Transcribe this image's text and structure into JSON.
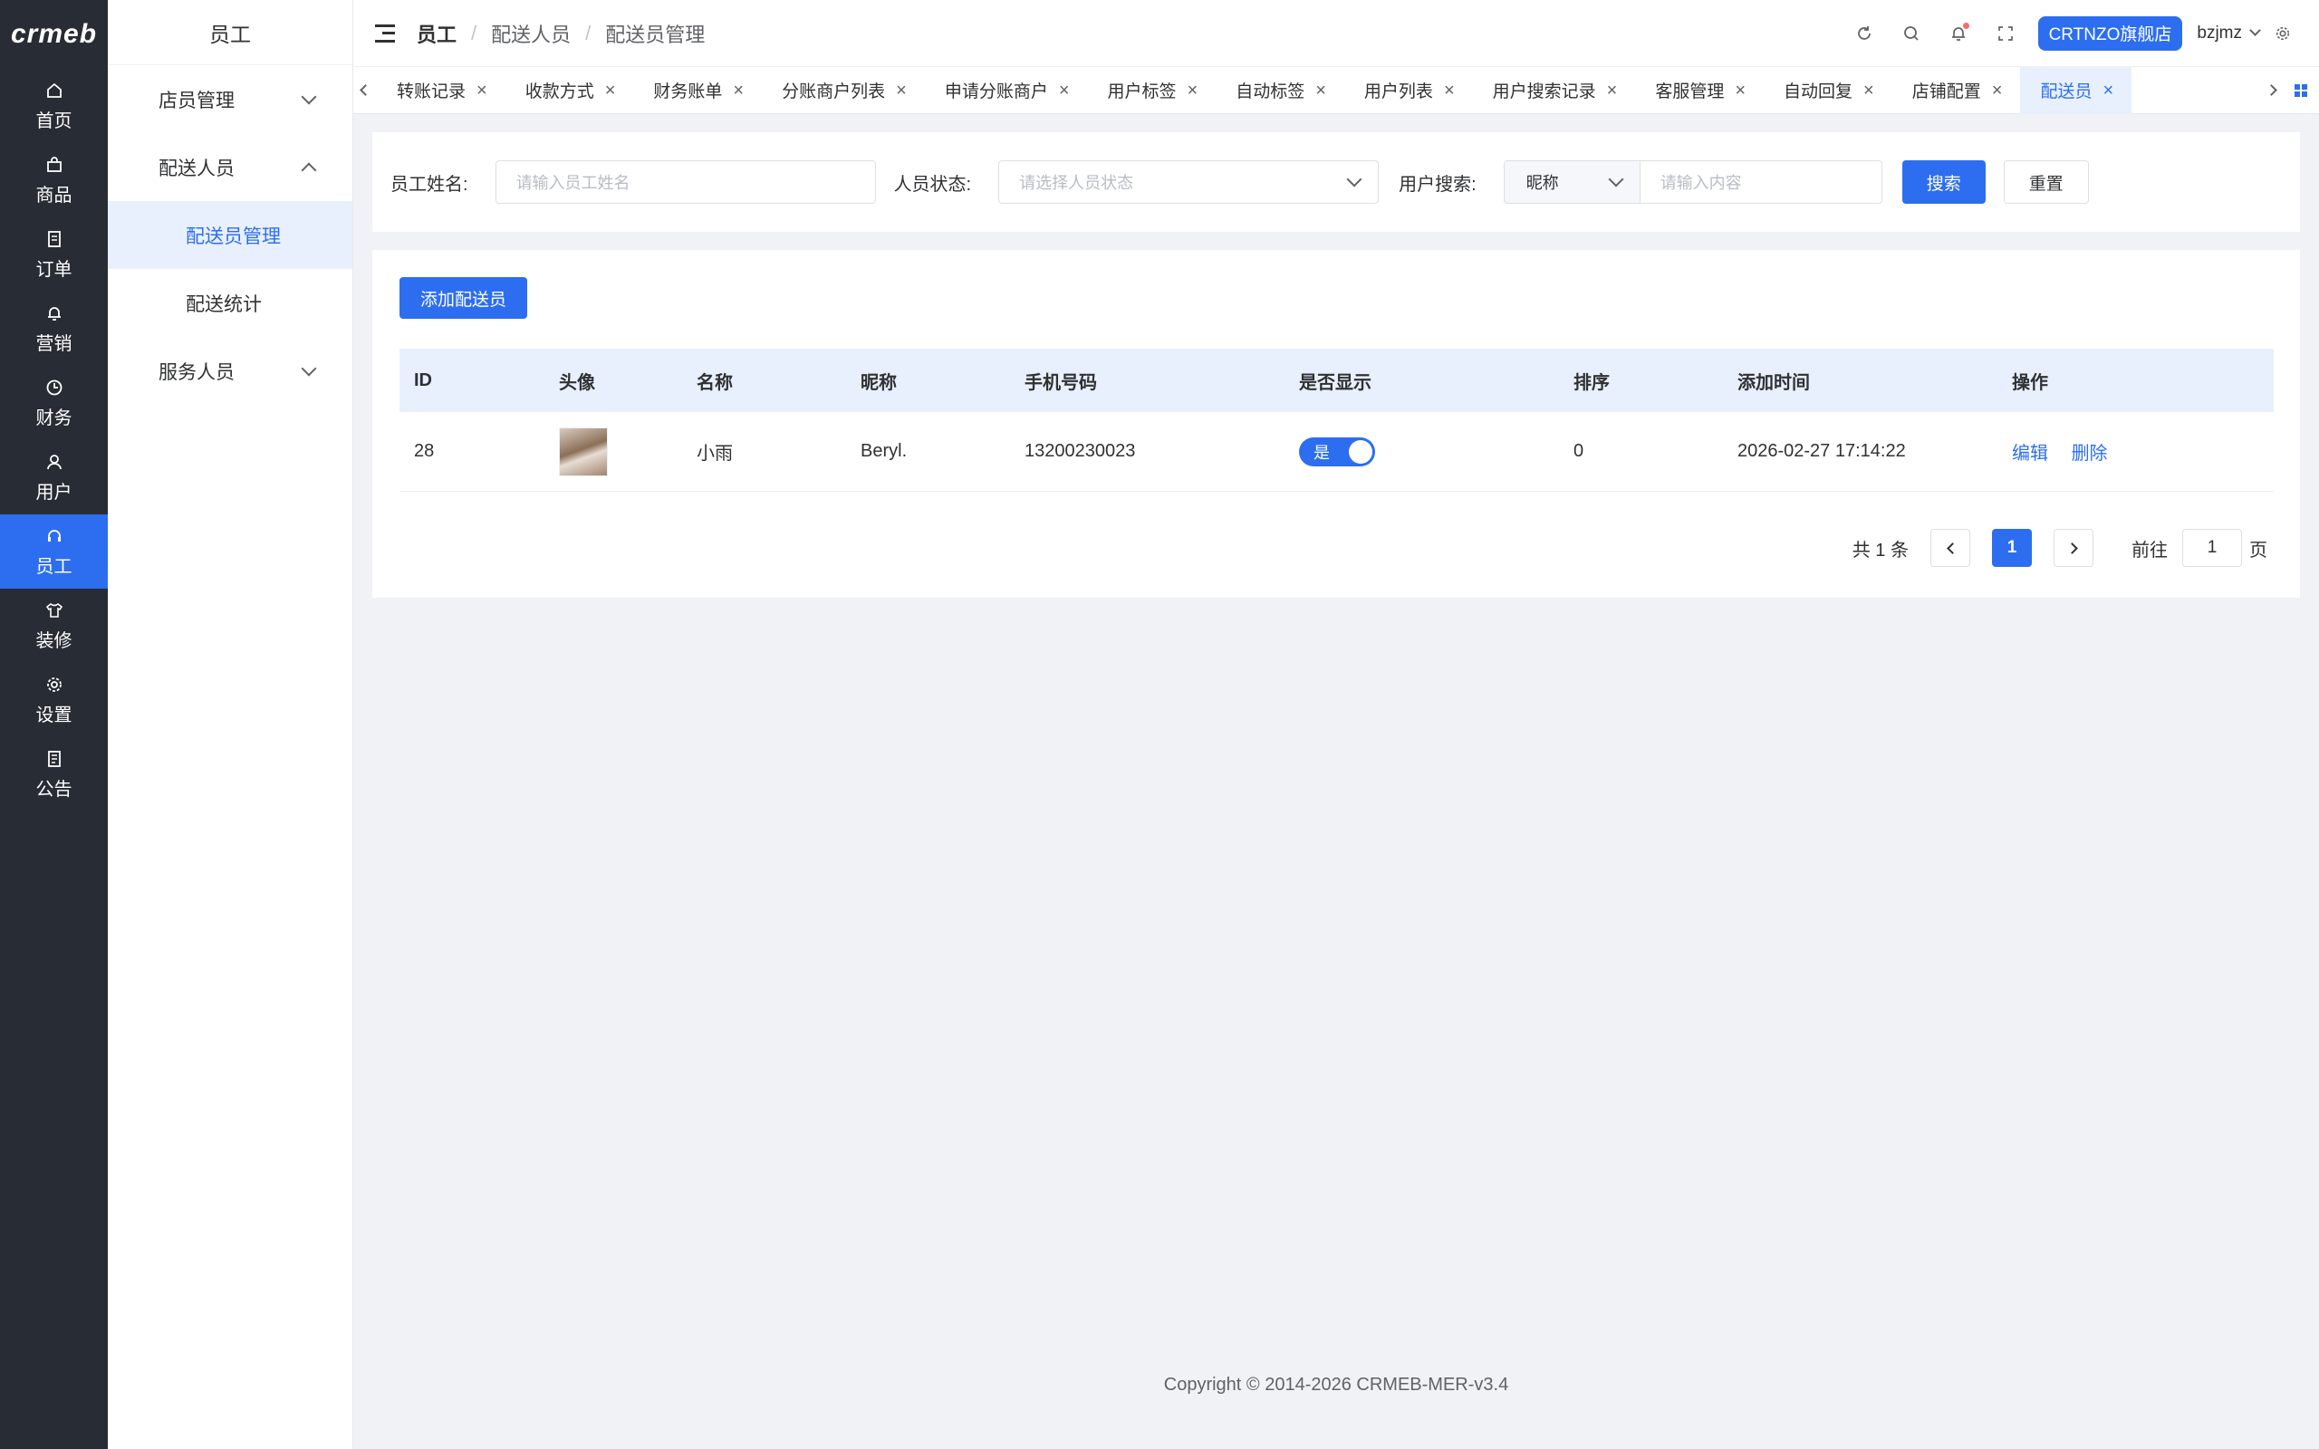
{
  "rail": {
    "logo": "crmeb",
    "items": [
      {
        "label": "首页",
        "icon": "home-icon"
      },
      {
        "label": "商品",
        "icon": "bag-icon"
      },
      {
        "label": "订单",
        "icon": "doc-icon"
      },
      {
        "label": "营销",
        "icon": "bell-icon"
      },
      {
        "label": "财务",
        "icon": "clock-icon"
      },
      {
        "label": "用户",
        "icon": "user-icon"
      },
      {
        "label": "员工",
        "icon": "headset-icon"
      },
      {
        "label": "装修",
        "icon": "shirt-icon"
      },
      {
        "label": "设置",
        "icon": "gear-icon"
      },
      {
        "label": "公告",
        "icon": "notice-icon"
      }
    ]
  },
  "submenu": {
    "title": "员工",
    "groups": [
      {
        "label": "店员管理"
      },
      {
        "label": "配送人员"
      },
      {
        "label": "配送员管理"
      },
      {
        "label": "配送统计"
      },
      {
        "label": "服务人员"
      }
    ]
  },
  "header": {
    "breadcrumbs": [
      "员工",
      "配送人员",
      "配送员管理"
    ],
    "store_button": "CRTNZO旗舰店",
    "username": "bzjmz"
  },
  "tabs": [
    "转账记录",
    "收款方式",
    "财务账单",
    "分账商户列表",
    "申请分账商户",
    "用户标签",
    "自动标签",
    "用户列表",
    "用户搜索记录",
    "客服管理",
    "自动回复",
    "店铺配置",
    "配送员"
  ],
  "filters": {
    "name_label": "员工姓名:",
    "name_placeholder": "请输入员工姓名",
    "status_label": "人员状态:",
    "status_placeholder": "请选择人员状态",
    "search_label": "用户搜索:",
    "search_type": "昵称",
    "search_placeholder": "请输入内容",
    "search_button": "搜索",
    "reset_button": "重置"
  },
  "table": {
    "add_button": "添加配送员",
    "columns": [
      "ID",
      "头像",
      "名称",
      "昵称",
      "手机号码",
      "是否显示",
      "排序",
      "添加时间",
      "操作"
    ],
    "rows": [
      {
        "id": "28",
        "name": "小雨",
        "nickname": "Beryl.",
        "phone": "13200230023",
        "show": "是",
        "sort": "0",
        "time": "2026-02-27 17:14:22",
        "edit": "编辑",
        "delete": "删除"
      }
    ]
  },
  "pagination": {
    "total": "共 1 条",
    "current": "1",
    "goto_label": "前往",
    "goto_value": "1",
    "page_suffix": "页"
  },
  "footer": "Copyright © 2014-2026 CRMEB-MER-v3.4",
  "colors": {
    "accent": "#2d6ef0",
    "rail_bg": "#282c34",
    "active_bg": "#e8f0fe"
  }
}
